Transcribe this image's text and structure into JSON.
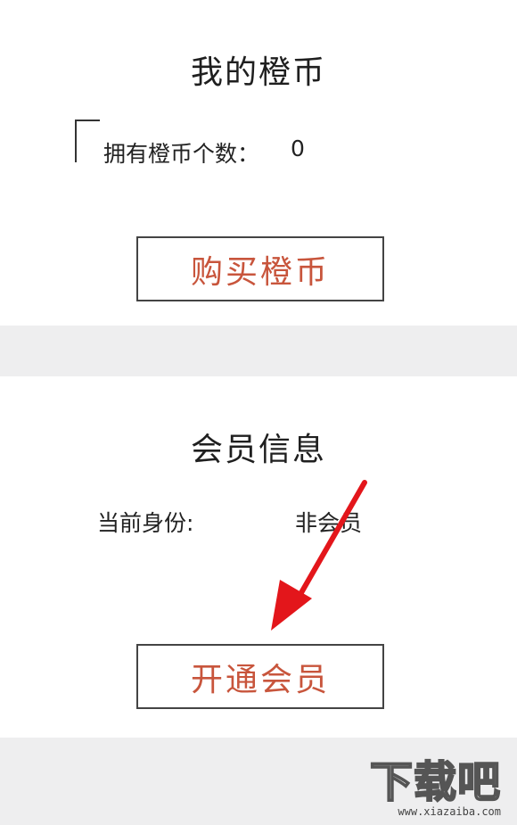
{
  "coins": {
    "title": "我的橙币",
    "count_label": "拥有橙币个数：",
    "count_value": "0",
    "buy_button": "购买橙币"
  },
  "member": {
    "title": "会员信息",
    "identity_label": "当前身份:",
    "identity_value": "非会员",
    "open_button": "开通会员"
  },
  "watermark": {
    "logo": "下载吧",
    "url": "www.xiazaiba.com"
  },
  "colors": {
    "accent_text": "#c8553c",
    "arrow": "#e3161b",
    "separator": "#eeeeef"
  }
}
